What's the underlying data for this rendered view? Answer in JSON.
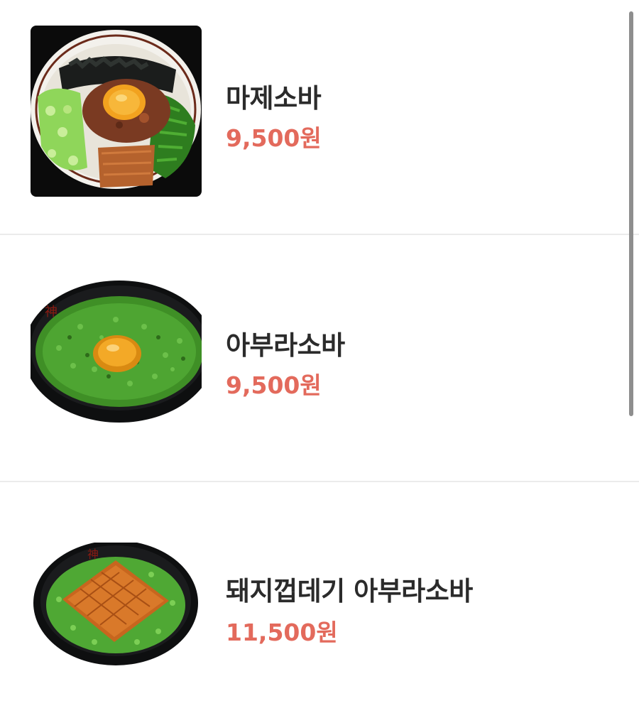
{
  "menu": {
    "items": [
      {
        "name": "마제소바",
        "price": "9,500원",
        "image_icon": "mazesoba-bowl-photo"
      },
      {
        "name": "아부라소바",
        "price": "9,500원",
        "image_icon": "aburasoba-bowl-photo"
      },
      {
        "name": "돼지껍데기 아부라소바",
        "price": "11,500원",
        "image_icon": "pork-skin-aburasoba-bowl-photo"
      }
    ]
  },
  "colors": {
    "price": "#e36a5c",
    "name": "#2b2b2b",
    "divider": "#ebebeb",
    "scrollbar": "#8e8e8e"
  }
}
